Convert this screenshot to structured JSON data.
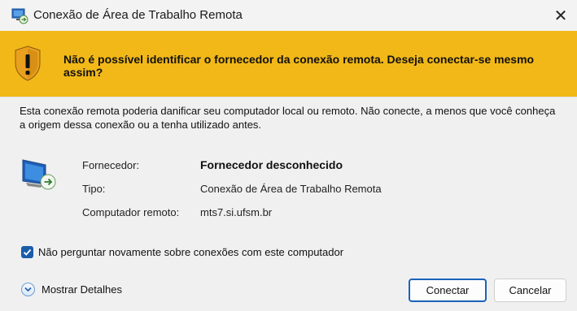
{
  "window": {
    "title": "Conexão de Área de Trabalho Remota",
    "close_glyph": "✕"
  },
  "warning": {
    "message": "Não é possível identificar o fornecedor da conexão remota. Deseja conectar-se mesmo assim?",
    "icon": "shield-warning-icon"
  },
  "description": "Esta conexão remota poderia danificar seu computador local ou remoto. Não conecte, a menos que você conheça a origem dessa conexão ou a tenha utilizado antes.",
  "info": {
    "fornecedor_label": "Fornecedor:",
    "fornecedor_value": "Fornecedor desconhecido",
    "tipo_label": "Tipo:",
    "tipo_value": "Conexão de Área de Trabalho Remota",
    "computador_label": "Computador remoto:",
    "computador_value": "mts7.si.ufsm.br"
  },
  "checkbox": {
    "label": "Não perguntar novamente sobre conexões com este computador",
    "checked": true
  },
  "details": {
    "label": "Mostrar Detalhes"
  },
  "buttons": {
    "connect": "Conectar",
    "cancel": "Cancelar"
  },
  "colors": {
    "warning_band": "#f2b817",
    "accent": "#1a5ea8"
  }
}
